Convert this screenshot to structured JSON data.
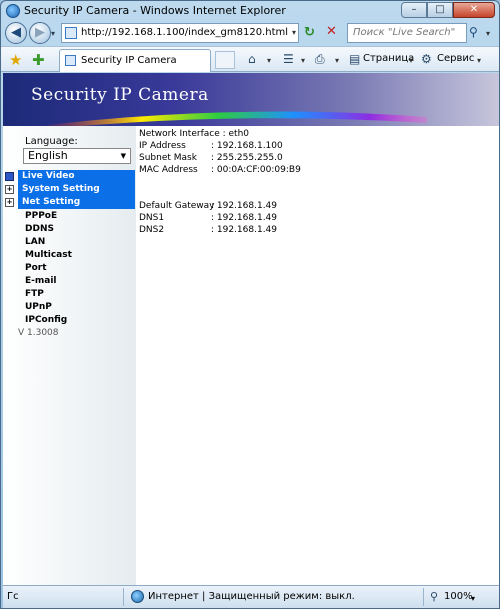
{
  "window": {
    "title": "Security IP Camera - Windows Internet Explorer",
    "min": "–",
    "max": "□",
    "close": "✕"
  },
  "nav": {
    "back": "◀",
    "forward": "▶",
    "dropdown": "▾",
    "url": "http://192.168.1.100/index_gm8120.html",
    "refresh": "↻",
    "stop": "✕",
    "search_placeholder": "Поиск \"Live Search\"",
    "search_go": "⚲"
  },
  "command_bar": {
    "tab_label": "Security IP Camera",
    "home": "⌂",
    "feeds": "☰",
    "print": "⎙",
    "page_menu": "Страница",
    "tools_menu": "Сервис",
    "dropdown": "▾"
  },
  "banner": {
    "title": "Security IP Camera"
  },
  "sidebar": {
    "language_label": "Language:",
    "language_value": "English",
    "language_arrow": "▼",
    "menus": [
      {
        "label": "Live Video",
        "box": ""
      },
      {
        "label": "System Setting",
        "box": "+"
      },
      {
        "label": "Net Setting",
        "box": "+"
      }
    ],
    "submenu": [
      "PPPoE",
      "DDNS",
      "LAN",
      "Multicast",
      "Port",
      "E-mail",
      "FTP",
      "UPnP",
      "IPConfig"
    ],
    "version": "V 1.3008"
  },
  "network_info": [
    {
      "key": "Network Interface",
      "value": ": eth0",
      "inline": true
    },
    {
      "key": "IP Address",
      "value": ": 192.168.1.100"
    },
    {
      "key": "Subnet Mask",
      "value": ": 255.255.255.0"
    },
    {
      "key": "MAC Address",
      "value": ": 00:0A:CF:00:09:B9"
    },
    {
      "key": "Default Gateway",
      "value": ": 192.168.1.49"
    },
    {
      "key": "DNS1",
      "value": ": 192.168.1.49"
    },
    {
      "key": "DNS2",
      "value": ": 192.168.1.49"
    }
  ],
  "status_bar": {
    "left": "Гс",
    "zone": "Интернет | Защищенный режим: выкл.",
    "zoom": "100%",
    "zoom_drop": "▾"
  },
  "colors": {
    "menu_blue": "#0b6fe8",
    "banner_dark": "#1c2a78",
    "banner_light": "#c7c6dc"
  }
}
